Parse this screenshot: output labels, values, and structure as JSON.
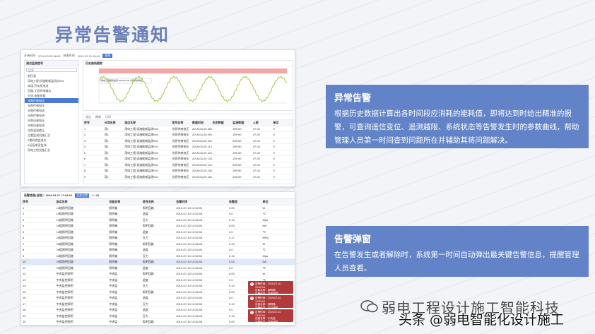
{
  "title": "异常告警通知",
  "shot1": {
    "top": {
      "start_label": "开始时间",
      "start": "2019-03-20 08:00",
      "end_label": "结束时间",
      "end": "2019-03-21 08:00",
      "query": "查询"
    },
    "tree": {
      "title": "测点监测信号",
      "search_placeholder": "搜索",
      "items": [
        "根目录",
        "用电工程/设施能耗监测点001",
        "本组-开关柜电流",
        "回路-工程供电输出",
        "分项-电能质量",
        "光照传感电压",
        "光照传感电压",
        "光照传感电流",
        "光照传感电流",
        "光照风速电压",
        "光照风速电流",
        "光照温湿度压",
        "主要监测设施汇总",
        "2楼机房监测点",
        "A区配电室监测",
        "用电工程设施汇总"
      ],
      "selected_index": 5
    },
    "chart_title": "历史曲线趋势",
    "chart_annotation": "用电工程能耗监测 2019-03-20 光照传感电压",
    "table": {
      "toolbar": [
        "导出",
        "刷新",
        "打印"
      ],
      "columns": [
        "序号",
        "分项名称",
        "测点名称",
        "信号名称",
        "数据时间",
        "历史数据",
        "监测数据",
        "上限",
        "单位"
      ],
      "rows": [
        [
          "1",
          "项1",
          "用电工程/设施能耗监测001",
          "光照传感电压",
          "2019-03-20 08:00",
          "-",
          "209.00",
          "47.00",
          "V"
        ],
        [
          "2",
          "项1",
          "用电工程/设施能耗监测001",
          "光照传感电压",
          "2019-03-20 09:00",
          "-",
          "209.00",
          "47.00",
          "V"
        ],
        [
          "3",
          "项1",
          "用电工程/设施能耗监测001",
          "光照传感电压",
          "2019-03-20 10:00",
          "-",
          "209.00",
          "47.00",
          "V"
        ],
        [
          "4",
          "项1",
          "用电工程/设施能耗监测001",
          "光照传感电压",
          "2019-03-20 11:00",
          "-",
          "209.00",
          "47.00",
          "V"
        ],
        [
          "5",
          "项1",
          "用电工程/设施能耗监测001",
          "光照传感电压",
          "2019-03-20 12:00",
          "-",
          "209.00",
          "47.00",
          "V"
        ],
        [
          "6",
          "项1",
          "用电工程/设施能耗监测001",
          "光照传感电压",
          "2019-03-20 13:00",
          "-",
          "209.00",
          "47.00",
          "V"
        ],
        [
          "7",
          "项1",
          "用电工程/设施能耗监测001",
          "光照传感电压",
          "2019-03-20 14:00",
          "-",
          "209.00",
          "47.00",
          "V"
        ],
        [
          "8",
          "项1",
          "用电工程/设施能耗监测001",
          "光照传感电压",
          "2019-03-20 15:00",
          "-",
          "209.00",
          "47.00",
          "V"
        ],
        [
          "9",
          "项1",
          "用电工程/设施能耗监测001",
          "光照传感电压",
          "2019-03-20 16:00",
          "-",
          "209.00",
          "47.00",
          "V"
        ]
      ]
    }
  },
  "callout1": {
    "title": "异常告警",
    "body": "根据历史数据计算出各时间段应消耗的能耗值，即将达到时给出精准的报警，可查询遥信变位、遥测越限、系统状态等告警发生时的参数曲线，帮助管理人员第一时间查到问题所在并辅助其将问题解决。"
  },
  "callout2": {
    "title": "告警弹窗",
    "body": "在告警发生或者解除时，系统第一时间自动弹出最关键告警信息，提醒管理人员查看。"
  },
  "shot2": {
    "header": "告警信息(当前)：2019-03-27 17:03:01",
    "tag": "全部告警",
    "pager": "1 / 20",
    "columns": [
      "序号",
      "测点名称",
      "设备名称",
      "信号名称",
      "告警时间",
      "告警值",
      "单位"
    ],
    "rows": [
      [
        "1",
        "1#楼照明回路",
        "照明箱",
        "照明回路",
        "2019-07-10 13:52:04",
        "0.00",
        "W"
      ],
      [
        "2",
        "1#楼照明回路",
        "照明箱",
        "温度",
        "2019-07-10 13:52:04",
        "0.0",
        "℃"
      ],
      [
        "3",
        "1#楼照明回路",
        "照明箱",
        "压力",
        "2019-07-10 13:52:04",
        "0.10",
        "Mpa"
      ],
      [
        "4",
        "1#楼照明回路",
        "照明箱",
        "照明回路",
        "2019-07-10 13:52:04",
        "0.00",
        "kW"
      ],
      [
        "5",
        "1#楼照明回路",
        "照明箱",
        "温度",
        "2019-07-10 13:52:04",
        "0.0",
        "℃"
      ],
      [
        "6",
        "2#楼照明回路",
        "照明箱",
        "压力",
        "2019-07-10 13:52:04",
        "2.17",
        "MPa"
      ],
      [
        "7",
        "2#楼照明回路",
        "照明箱",
        "照明回路",
        "2019-07-10 13:52:04",
        "0.20",
        "W"
      ],
      [
        "8",
        "2#楼照明回路",
        "照明箱",
        "温度",
        "2019-07-10 13:52:04",
        "0.0",
        "℃"
      ],
      [
        "9",
        "2#楼照明回路",
        "照明箱",
        "压力",
        "2019-07-10 13:52:04",
        "0.10",
        "Mpa"
      ],
      [
        "10",
        "2#楼照明回路",
        "照明箱",
        "照明回路",
        "2019-07-10 13:52:04",
        "0.00",
        "kW"
      ],
      [
        "11",
        "2#楼照明回路",
        "照明箱",
        "温度",
        "2019-07-10 13:52:04",
        "0.0",
        "℃"
      ],
      [
        "12",
        "中央监控照明",
        "中央监",
        "照明回路",
        "2019-07-10 13:52:04",
        "0.00",
        "W"
      ],
      [
        "13",
        "中央监控照明",
        "中央监",
        "温度",
        "2019-07-10 13:52:04",
        "0.0",
        "℃"
      ],
      [
        "14",
        "中央监控照明",
        "中央监",
        "压力",
        "2019-07-10 13:52:04",
        "0.10",
        "Mpa"
      ],
      [
        "15",
        "中央监控照明",
        "中央监",
        "照明回路",
        "2019-07-10 13:52:04",
        "0.00",
        "W"
      ],
      [
        "16",
        "中央监控照明",
        "中央监",
        "温度",
        "2019-07-10 13:52:04",
        "0.0",
        "℃"
      ],
      [
        "17",
        "中央监控照明",
        "中央监",
        "压力",
        "2019-07-10 13:52:04",
        "0.10",
        "Mpa"
      ],
      [
        "18",
        "中央监控照明",
        "中央监",
        "温度",
        "2019-07-10 13:52:04",
        "0.0",
        "℃"
      ],
      [
        "19",
        "中央监控照明",
        "中央监",
        "压力",
        "2019-07-10 13:52:04",
        "0.10",
        "Mpa"
      ],
      [
        "20",
        "中央监控照明",
        "中央监",
        "照明回路",
        "2019-07-10 13:52:04",
        "0.00",
        "W"
      ]
    ],
    "highlight_index": 9,
    "popups": [
      [
        "告警时间：2019-07-10 13:52:04",
        "设备名称：照明箱",
        "告警信息：温度超限"
      ],
      [
        "告警时间：2019-07-10 13:52:04",
        "设备名称：照明箱",
        "告警信息：压力超限"
      ],
      [
        "告警时间：2019-07-10 13:52:04",
        "设备名称：中央监",
        "告警信息：温度超限"
      ]
    ]
  },
  "watermark_top": "弱电工程设计施工智能科技",
  "watermark_bottom": "头条 @弱电智能化设计施工",
  "colors": {
    "accent": "#6283c8",
    "title": "#6b7fb8",
    "alarm": "#b33a3a",
    "series": "#9bc53d",
    "limit_band": "#f4a5a5"
  }
}
